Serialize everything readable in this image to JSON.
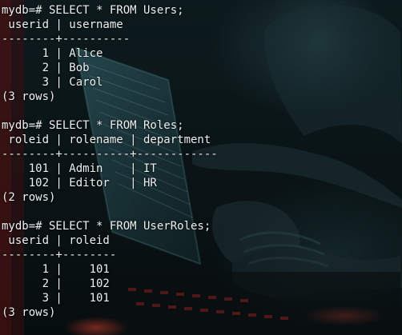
{
  "terminal": {
    "lines": [
      "mydb=# SELECT * FROM Users;",
      " userid | username",
      "--------+----------",
      "      1 | Alice",
      "      2 | Bob",
      "      3 | Carol",
      "(3 rows)",
      "",
      "mydb=# SELECT * FROM Roles;",
      " roleid | rolename | department",
      "--------+----------+------------",
      "    101 | Admin    | IT",
      "    102 | Editor   | HR",
      "(2 rows)",
      "",
      "mydb=# SELECT * FROM UserRoles;",
      " userid | roleid",
      "--------+--------",
      "      1 |    101",
      "      2 |    102",
      "      3 |    101",
      "(3 rows)"
    ]
  },
  "colors": {
    "text": "#eef2f2",
    "background": "#0b1114",
    "accent_teal": "#1f3b40",
    "accent_red": "#b0302a"
  }
}
